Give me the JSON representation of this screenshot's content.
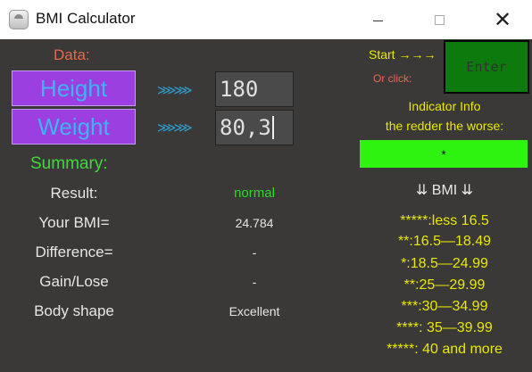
{
  "window": {
    "title": "BMI Calculator",
    "minimize_symbol": "",
    "close_symbol": "✕"
  },
  "inputs": {
    "data_label": "Data:",
    "height_button": "Height",
    "weight_button": "Weight",
    "arrows": "⋙⋙",
    "height_value": "180",
    "weight_value": "80,3"
  },
  "summary": {
    "title": "Summary:",
    "rows": [
      {
        "label": "Result:",
        "value": "normal"
      },
      {
        "label": "Your BMI=",
        "value": "24.784"
      },
      {
        "label": "Difference=",
        "value": "-"
      },
      {
        "label": "Gain/Lose",
        "value": "-"
      },
      {
        "label": "Body shape",
        "value": "Excellent"
      }
    ]
  },
  "right_panel": {
    "start_label": "Start →→→",
    "or_click": "Or click:",
    "enter_button": "Enter",
    "indicator_info_1": "Indicator Info",
    "indicator_info_2": "the redder the worse:",
    "indicator_value": "*",
    "indicator_color": "#2ef20f",
    "bmi_header": "⇊ BMI ⇊",
    "scale": [
      "*****:less 16.5",
      "**:16.5—18.49",
      "*:18.5—24.99",
      "**:25—29.99",
      "***:30—34.99",
      "****: 35—39.99",
      "*****: 40 and more"
    ]
  }
}
